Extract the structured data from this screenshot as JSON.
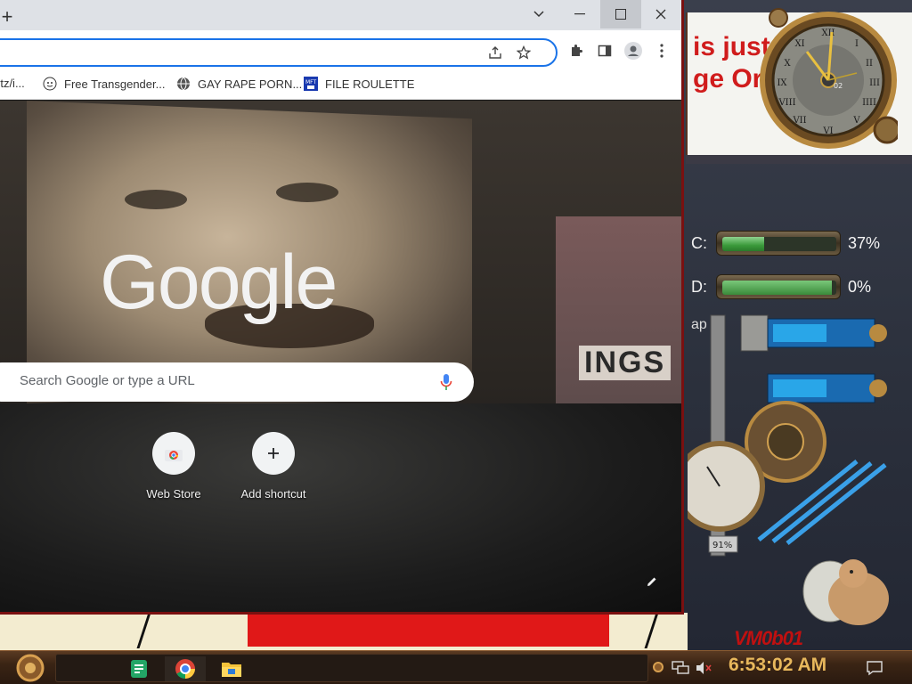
{
  "desktop": {
    "banner_line1": "is just",
    "banner_line2": "ge Orwell",
    "clock_face_number": "02",
    "drives": [
      {
        "letter": "C:",
        "percent_text": "37%",
        "percent": 37
      },
      {
        "letter": "D:",
        "percent_text": "0%",
        "percent": 0
      }
    ],
    "gauge_readout": "91%",
    "partial_text": "ap",
    "label": "VM0b01"
  },
  "browser": {
    "new_tab_symbol": "+",
    "omnibox_value": "",
    "bookmarks": [
      {
        "label": "rtz/i...",
        "icon": "page-icon"
      },
      {
        "label": "Free Transgender...",
        "icon": "site-favicon"
      },
      {
        "label": "GAY RAPE PORN...",
        "icon": "globe-icon"
      },
      {
        "label": "FILE ROULETTE",
        "icon": "mft-favicon"
      }
    ],
    "ntp": {
      "logo": "Google",
      "search_placeholder": "Search Google or type a URL",
      "sign_text": "INGS",
      "shortcuts": [
        {
          "label": "Web Store",
          "icon": "chrome-web-store-icon"
        },
        {
          "label": "Add shortcut",
          "icon": "plus-icon"
        }
      ]
    }
  },
  "taskbar": {
    "time": "6:53:02 AM",
    "apps": [
      "sheets-icon",
      "chrome-icon",
      "file-explorer-icon"
    ]
  },
  "colors": {
    "accent_blue": "#1a73e8",
    "banner_red": "#d01c1c",
    "clock_amber": "#e8b85c",
    "drive_green": "#3a9a3a"
  }
}
